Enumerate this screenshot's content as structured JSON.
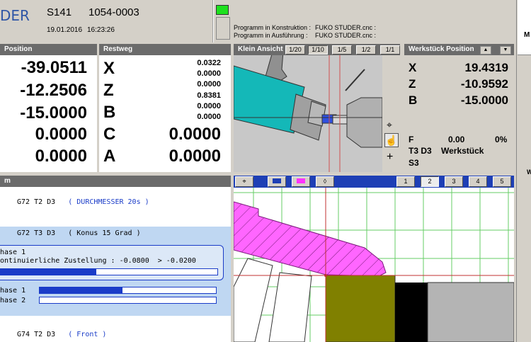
{
  "header": {
    "brand": "DER",
    "machine": "S141",
    "program_number": "1054-0003",
    "date": "19.01.2016",
    "time": "16:23:26",
    "status_color": "#1ee01e",
    "program_construction_label": "Programm in Konstruktion :",
    "program_construction_value": "FUKO STUDER.cnc  :",
    "program_execution_label": "Programm in Ausführung :",
    "program_execution_value": "FUKO STUDER.cnc  :"
  },
  "position": {
    "title": "Position",
    "values": [
      "-39.0511",
      "-12.2506",
      "-15.0000",
      "0.0000",
      "0.0000"
    ]
  },
  "restweg": {
    "title": "Restweg",
    "axes": [
      "X",
      "Z",
      "B",
      "C",
      "A"
    ],
    "small_values": [
      "0.0322",
      "0.0000",
      "0.0000",
      "0.8381",
      "0.0000",
      "0.0000"
    ],
    "c_value": "0.0000",
    "a_value": "0.0000"
  },
  "klein_ansicht": {
    "title": "Klein Ansicht",
    "zoom_buttons": [
      "1/20",
      "1/10",
      "1/5",
      "1/2",
      "1/1"
    ],
    "active_zoom": "1/10",
    "tools": [
      "crosshair-icon",
      "hand-icon",
      "plus-icon"
    ]
  },
  "werkstueck": {
    "title": "Werkstück Position",
    "axes": [
      {
        "label": "X",
        "value": "19.4319"
      },
      {
        "label": "Z",
        "value": "-10.9592"
      },
      {
        "label": "B",
        "value": "-15.0000"
      }
    ],
    "feed_label": "F",
    "feed_value": "0.00",
    "feed_percent": "0%",
    "tool": "T3 D3",
    "coord_system": "Werkstück",
    "spindle": "S3"
  },
  "program": {
    "title": "m",
    "lines": [
      {
        "code": "G72 T2 D3",
        "comment": "( DURCHMESSER 20s )"
      },
      {
        "code": "G72 T3 D3",
        "comment": "( Konus 15 Grad )"
      },
      {
        "code": "G74 T2 D3",
        "comment": "( Front )"
      }
    ],
    "phase_header": "hase 1",
    "infeed_text": "ontinuierliche Zustellung : -0.0800  > -0.0200",
    "infeed_progress": 0.44,
    "phase1_label": "hase 1",
    "phase1_progress": 0.47,
    "phase2_label": "hase 2",
    "phase2_progress": 0.0
  },
  "large_view": {
    "tool_buttons": [
      "crosshair-icon",
      "view-mode-icon",
      "magenta-swatch-icon",
      "diamond-icon"
    ],
    "page_buttons": [
      "1",
      "2",
      "3",
      "4",
      "5"
    ],
    "active_page": "2"
  },
  "right_strip": {
    "top_label": "M",
    "side_label": "W"
  }
}
